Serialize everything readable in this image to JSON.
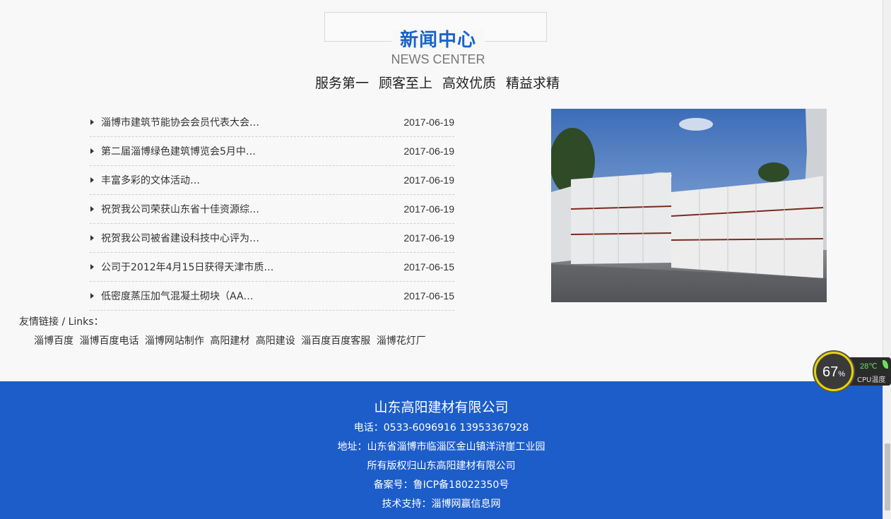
{
  "header": {
    "title_cn": "新闻中心",
    "title_en": "NEWS CENTER",
    "slogan": "服务第一  顾客至上  高效优质 精益求精"
  },
  "news": [
    {
      "title": "淄博市建筑节能协会会员代表大会…",
      "date": "2017-06-19"
    },
    {
      "title": "第二届淄博绿色建筑博览会5月中…",
      "date": "2017-06-19"
    },
    {
      "title": "丰富多彩的文体活动…",
      "date": "2017-06-19"
    },
    {
      "title": "祝贺我公司荣获山东省十佳资源综…",
      "date": "2017-06-19"
    },
    {
      "title": "祝贺我公司被省建设科技中心评为…",
      "date": "2017-06-19"
    },
    {
      "title": "公司于2012年4月15日获得天津市质…",
      "date": "2017-06-15"
    },
    {
      "title": "低密度蒸压加气混凝土砌块（AA…",
      "date": "2017-06-15"
    }
  ],
  "links": {
    "label": "友情链接 / Links：",
    "items": [
      "淄博百度",
      "淄博百度电话",
      "淄博网站制作",
      "高阳建材",
      "高阳建设",
      "淄百度百度客服",
      "淄博花灯厂"
    ]
  },
  "footer": {
    "company": "山东高阳建材有限公司",
    "phone": "电话：0533-6096916 13953367928",
    "address": "地址：山东省淄博市临淄区金山镇洋浒崖工业园",
    "copyright": "所有版权归山东高阳建材有限公司",
    "icp": "备案号：鲁ICP备18022350号",
    "support": "技术支持：淄博网赢信息网"
  },
  "cpu_widget": {
    "percent": "67",
    "percent_sign": "%",
    "temperature": "28℃",
    "label": "CPU温度",
    "ring_color": "#e5d400",
    "temp_color": "#6de05c"
  },
  "colors": {
    "accent": "#1a63c9",
    "footer_bg": "#1c5dc9"
  }
}
